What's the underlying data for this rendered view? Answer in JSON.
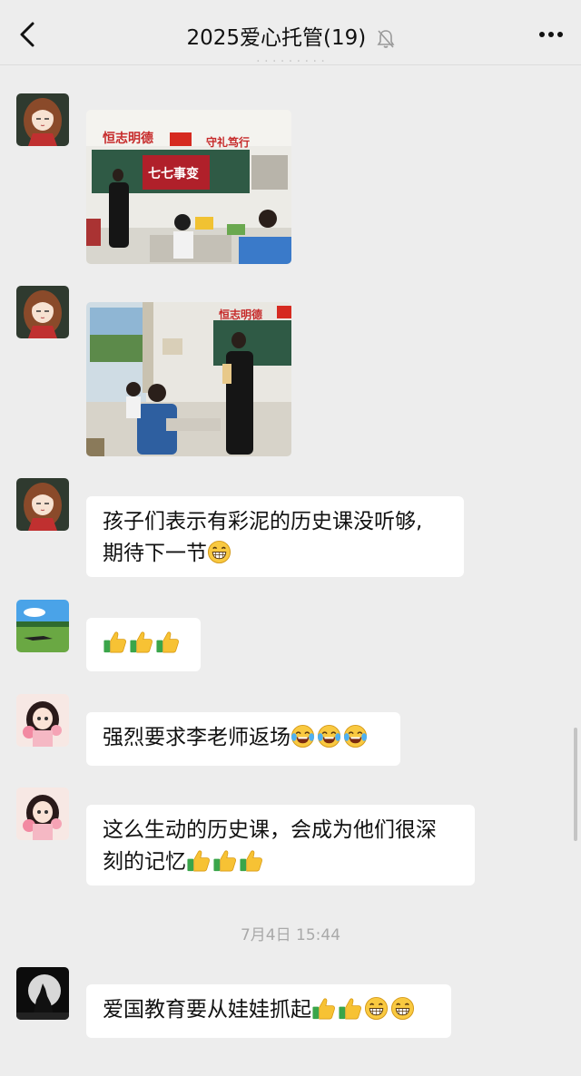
{
  "header": {
    "title": "2025爱心托管(19)",
    "back_icon": "chevron-left-icon",
    "mute_icon": "bell-off-icon",
    "more_icon": "more-dots-icon"
  },
  "messages": [
    {
      "type": "image",
      "avatar": "cartoon-girl-avatar",
      "image": "classroom-photo-1"
    },
    {
      "type": "image",
      "avatar": "cartoon-girl-avatar",
      "image": "classroom-photo-2"
    },
    {
      "type": "text",
      "avatar": "cartoon-girl-avatar",
      "lines": [
        "孩子们表示有彩泥的历史课没听够,",
        "期待下一节"
      ],
      "emoji": [
        "grin"
      ]
    },
    {
      "type": "text",
      "avatar": "grassland-avatar",
      "text": "",
      "emoji": [
        "thumbs-up",
        "thumbs-up",
        "thumbs-up"
      ]
    },
    {
      "type": "text",
      "avatar": "flower-girl-avatar",
      "text": "强烈要求李老师返场",
      "emoji": [
        "joy",
        "joy",
        "joy"
      ]
    },
    {
      "type": "text",
      "avatar": "flower-girl-avatar",
      "lines": [
        "这么生动的历史课，会成为他们很深",
        "刻的记忆"
      ],
      "emoji": [
        "thumbs-up",
        "thumbs-up",
        "thumbs-up"
      ]
    },
    {
      "type": "text",
      "avatar": "wolf-moon-avatar",
      "text": "爱国教育要从娃娃抓起",
      "emoji": [
        "thumbs-up",
        "thumbs-up",
        "grin",
        "grin"
      ]
    }
  ],
  "timestamp": "7月4日 15:44",
  "photo_texts": {
    "banner_left": "恒志明德",
    "banner_right": "守礼笃行",
    "screen_text": "七七事变",
    "banner2": "恒志明德"
  },
  "colors": {
    "background": "#ededed",
    "bubble": "#ffffff",
    "timestamp": "#a9a9a9"
  }
}
